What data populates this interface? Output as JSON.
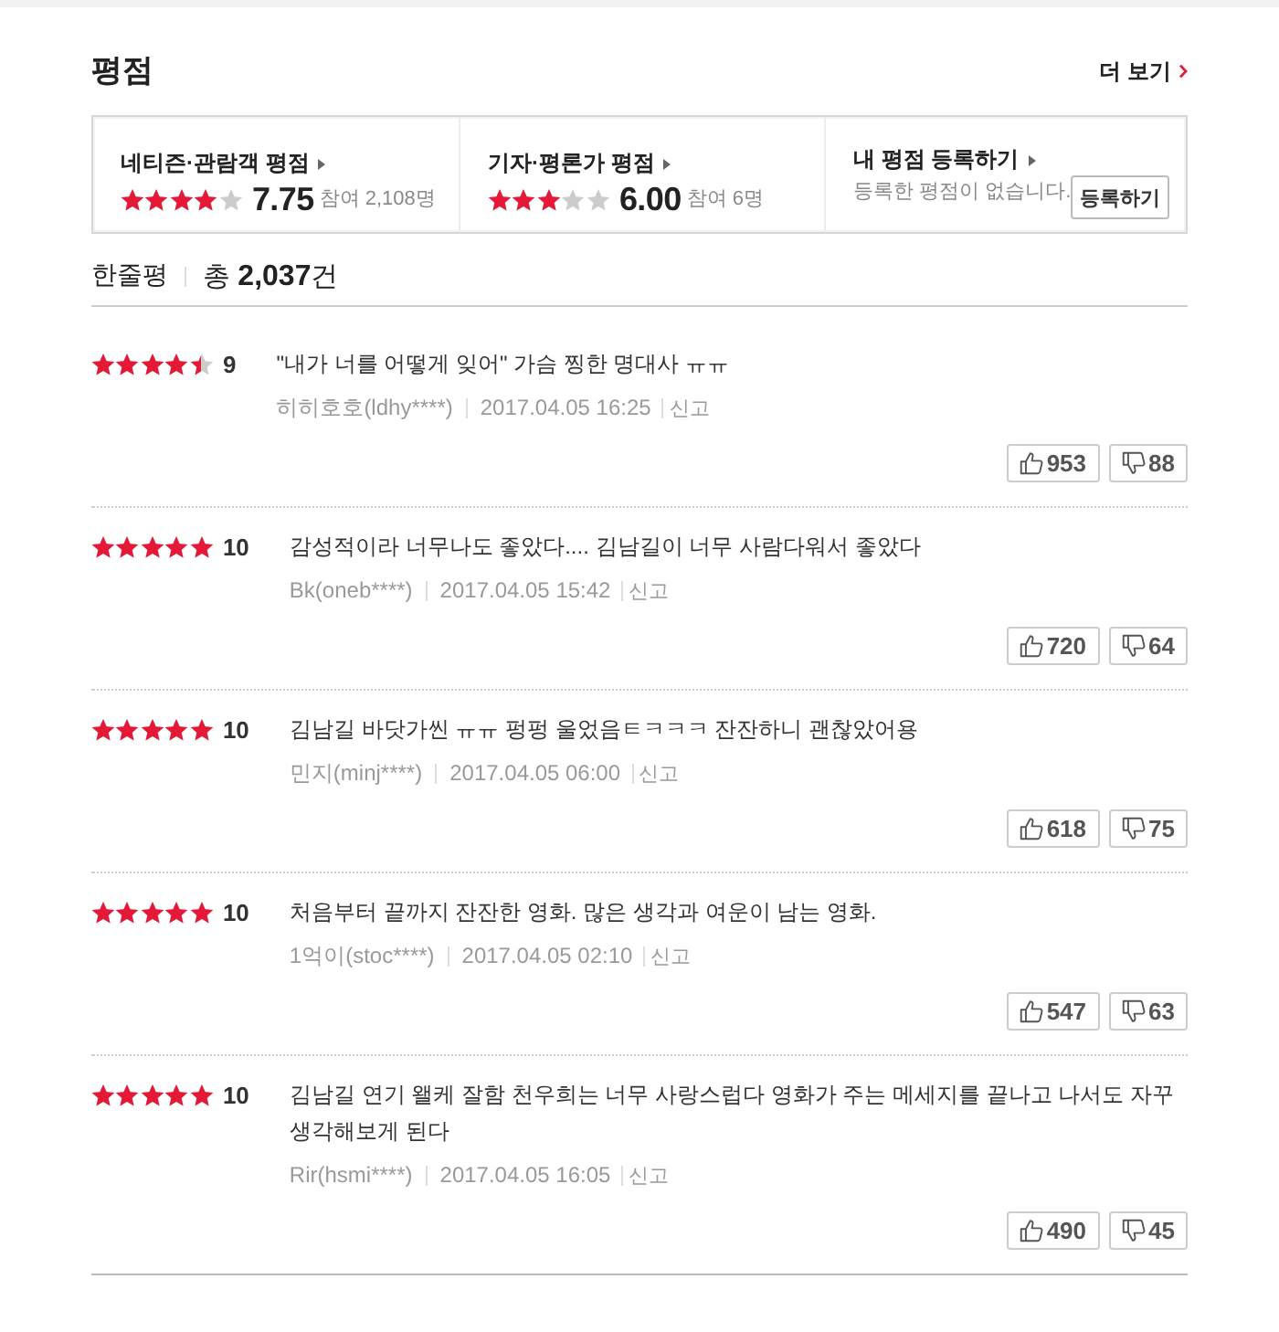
{
  "header": {
    "title": "평점",
    "more_link": "더 보기"
  },
  "summary": [
    {
      "kind": "rating",
      "label": "네티즌·관람객 평점",
      "stars": 4,
      "score": "7.75",
      "participants": "참여 2,108명"
    },
    {
      "kind": "rating",
      "label": "기자·평론가 평점",
      "stars": 3,
      "score": "6.00",
      "participants": "참여 6명"
    },
    {
      "kind": "register",
      "label": "내 평점 등록하기",
      "message": "등록한 평점이 없습니다.",
      "button": "등록하기"
    }
  ],
  "reviews_header": {
    "title": "한줄평",
    "total": "총 **2,037**건"
  },
  "reviews": [
    {
      "stars": 4.5,
      "score": "9",
      "text": "\"내가 너를 어떻게 잊어\" 가슴 찡한 명대사 ㅠㅠ",
      "author": "히히호호(ldhy****)",
      "date": "2017.04.05 16:25",
      "report": "신고",
      "likes": "953",
      "dislikes": "88"
    },
    {
      "stars": 5,
      "score": "10",
      "text": "감성적이라 너무나도 좋았다.... 김남길이 너무 사람다워서 좋았다",
      "author": "Bk(oneb****)",
      "date": "2017.04.05 15:42",
      "report": "신고",
      "likes": "720",
      "dislikes": "64"
    },
    {
      "stars": 5,
      "score": "10",
      "text": "김남길 바닷가씬 ㅠㅠ 펑펑 울었음ㅌㅋㅋㅋ 잔잔하니 괜찮았어용",
      "author": "민지(minj****)",
      "date": "2017.04.05 06:00",
      "report": "신고",
      "likes": "618",
      "dislikes": "75"
    },
    {
      "stars": 5,
      "score": "10",
      "text": "처음부터 끝까지 잔잔한 영화. 많은 생각과 여운이 남는 영화.",
      "author": "1억이(stoc****)",
      "date": "2017.04.05 02:10",
      "report": "신고",
      "likes": "547",
      "dislikes": "63"
    },
    {
      "stars": 5,
      "score": "10",
      "text": "김남길 연기 왤케 잘함 천우희는 너무 사랑스럽다 영화가 주는 메세지를 끝나고 나서도 자꾸 생각해보게 된다",
      "author": "Rir(hsmi****)",
      "date": "2017.04.05 16:05",
      "report": "신고",
      "likes": "490",
      "dislikes": "45"
    }
  ]
}
